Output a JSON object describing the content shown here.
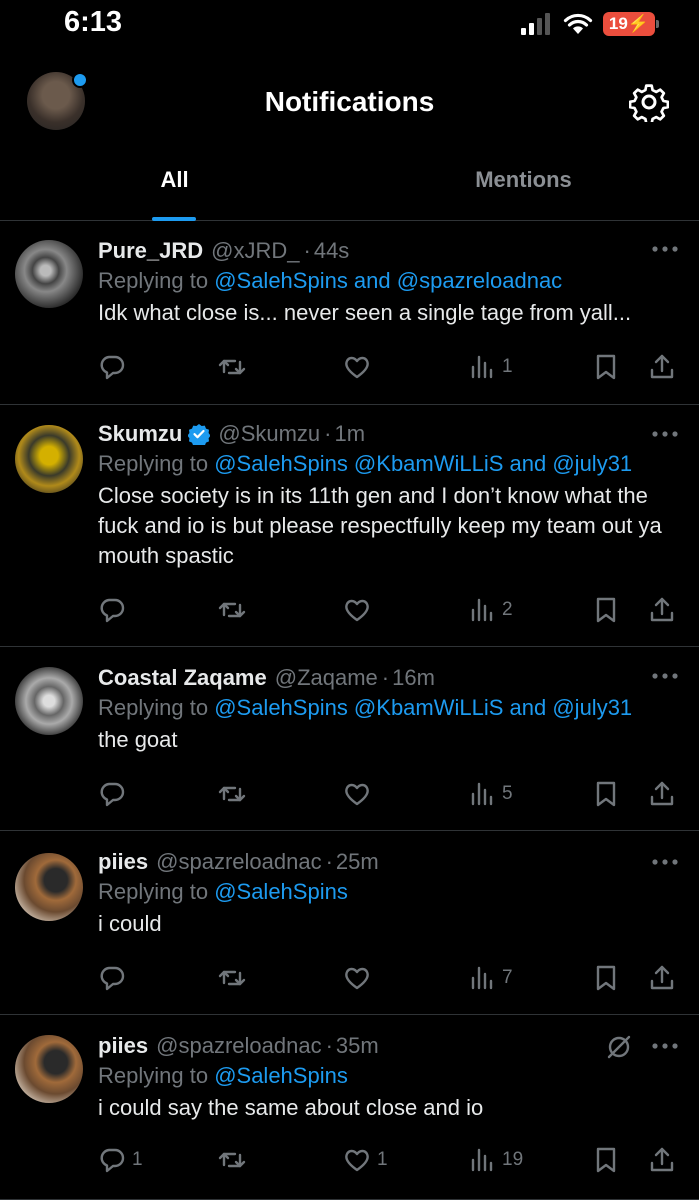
{
  "status": {
    "time": "6:13",
    "battery": "19"
  },
  "header": {
    "title": "Notifications"
  },
  "tabs": [
    {
      "label": "All"
    },
    {
      "label": "Mentions"
    }
  ],
  "tweets": [
    {
      "name": "Pure_JRD",
      "handle": "@xJRD_",
      "time": "44s",
      "reply_prefix": "Replying to ",
      "reply_mentions": "@SalehSpins and @spazreloadnac",
      "text": "Idk what close is... never seen a single tage from yall...",
      "replies": "",
      "retweets": "",
      "likes": "",
      "views": "1"
    },
    {
      "name": "Skumzu",
      "handle": "@Skumzu",
      "time": "1m",
      "verified": true,
      "reply_prefix": "Replying to ",
      "reply_mentions": "@SalehSpins @KbamWiLLiS and @july31",
      "text": "Close society is in its 11th gen and I don’t know what the fuck and io is but please respectfully keep my team out ya mouth spastic",
      "replies": "",
      "retweets": "",
      "likes": "",
      "views": "2"
    },
    {
      "name": "Coastal Zaqame",
      "handle": "@Zaqame",
      "time": "16m",
      "reply_prefix": "Replying to ",
      "reply_mentions": "@SalehSpins @KbamWiLLiS and @july31",
      "text": "the goat",
      "replies": "",
      "retweets": "",
      "likes": "",
      "views": "5"
    },
    {
      "name": "piies",
      "handle": "@spazreloadnac",
      "time": "25m",
      "reply_prefix": "Replying to ",
      "reply_mentions": "@SalehSpins",
      "text": "i could",
      "replies": "",
      "retweets": "",
      "likes": "",
      "views": "7"
    },
    {
      "name": "piies",
      "handle": "@spazreloadnac",
      "time": "35m",
      "reply_prefix": "Replying to ",
      "reply_mentions": "@SalehSpins",
      "text": "i could say the same about close and io",
      "replies": "1",
      "retweets": "",
      "likes": "1",
      "views": "19"
    }
  ],
  "colors": {
    "accent": "#1d9bf0",
    "muted": "#71767b",
    "battery": "#eb4e3d"
  }
}
